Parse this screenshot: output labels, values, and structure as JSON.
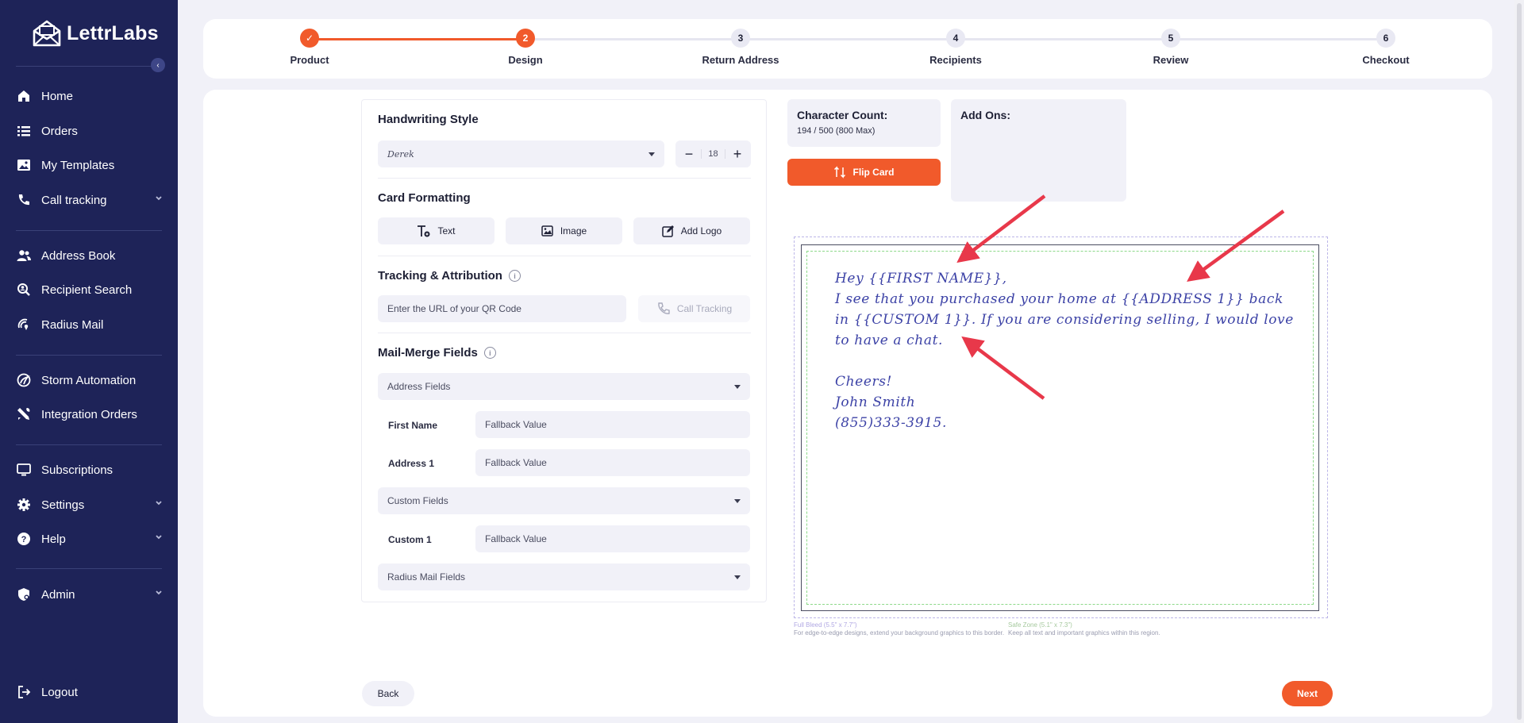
{
  "app": {
    "logo_text": "LettrLabs"
  },
  "sidebar": {
    "items": [
      {
        "id": "home",
        "label": "Home",
        "icon": "home-icon"
      },
      {
        "id": "orders",
        "label": "Orders",
        "icon": "list-icon"
      },
      {
        "id": "templates",
        "label": "My Templates",
        "icon": "image-icon"
      },
      {
        "id": "call-tracking",
        "label": "Call tracking",
        "icon": "phone-icon"
      },
      {
        "id": "address-book",
        "label": "Address Book",
        "icon": "users-icon"
      },
      {
        "id": "recipient-search",
        "label": "Recipient Search",
        "icon": "search-person-icon"
      },
      {
        "id": "radius-mail",
        "label": "Radius Mail",
        "icon": "radius-icon"
      },
      {
        "id": "storm",
        "label": "Storm Automation",
        "icon": "storm-icon"
      },
      {
        "id": "integration",
        "label": "Integration Orders",
        "icon": "tools-icon"
      },
      {
        "id": "subscriptions",
        "label": "Subscriptions",
        "icon": "monitor-icon"
      },
      {
        "id": "settings",
        "label": "Settings",
        "icon": "gear-icon"
      },
      {
        "id": "help",
        "label": "Help",
        "icon": "help-icon"
      },
      {
        "id": "admin",
        "label": "Admin",
        "icon": "admin-icon"
      },
      {
        "id": "logout",
        "label": "Logout",
        "icon": "logout-icon"
      }
    ]
  },
  "stepper": {
    "steps": [
      {
        "number": "✓",
        "label": "Product",
        "state": "done"
      },
      {
        "number": "2",
        "label": "Design",
        "state": "active"
      },
      {
        "number": "3",
        "label": "Return Address",
        "state": "todo"
      },
      {
        "number": "4",
        "label": "Recipients",
        "state": "todo"
      },
      {
        "number": "5",
        "label": "Review",
        "state": "todo"
      },
      {
        "number": "6",
        "label": "Checkout",
        "state": "todo"
      }
    ]
  },
  "editor": {
    "handwriting": {
      "title": "Handwriting Style",
      "font_value": "Derek",
      "size_value": "18",
      "minus": "−",
      "plus": "+"
    },
    "formatting": {
      "title": "Card Formatting",
      "text_label": "Text",
      "image_label": "Image",
      "logo_label": "Add Logo"
    },
    "tracking": {
      "title": "Tracking & Attribution",
      "qr_placeholder": "Enter the URL of your QR Code",
      "call_tracking_label": "Call Tracking"
    },
    "mail_merge": {
      "title": "Mail-Merge Fields",
      "address_fields": "Address Fields",
      "first_name_label": "First Name",
      "address1_label": "Address 1",
      "custom_fields": "Custom Fields",
      "custom1_label": "Custom 1",
      "radius_fields": "Radius Mail Fields",
      "fallback_placeholder": "Fallback Value"
    }
  },
  "preview": {
    "char_count_title": "Character Count:",
    "char_count_value": "194 / 500 (800 Max)",
    "flip_label": "Flip Card",
    "addons_title": "Add Ons:",
    "message_lines": [
      "Hey {{FIRST NAME}},",
      "I see that you purchased your home at {{ADDRESS 1}} back",
      "in {{CUSTOM 1}}. If you are considering selling, I would love",
      "to have a chat.",
      "",
      "Cheers!",
      "John Smith",
      "(855)333-3915."
    ],
    "full_bleed_title": "Full Bleed (5.5\" x 7.7\")",
    "full_bleed_desc": "For edge-to-edge designs, extend your background graphics to this border.",
    "safe_zone_title": "Safe Zone (5.1\" x 7.3\")",
    "safe_zone_desc": "Keep all text and important graphics within this region."
  },
  "nav": {
    "back_label": "Back",
    "next_label": "Next"
  },
  "colors": {
    "brand_orange": "#f15a2b",
    "sidebar_navy": "#1e2358",
    "handwriting_blue": "#3c42a6",
    "arrow_red": "#e8384a"
  }
}
